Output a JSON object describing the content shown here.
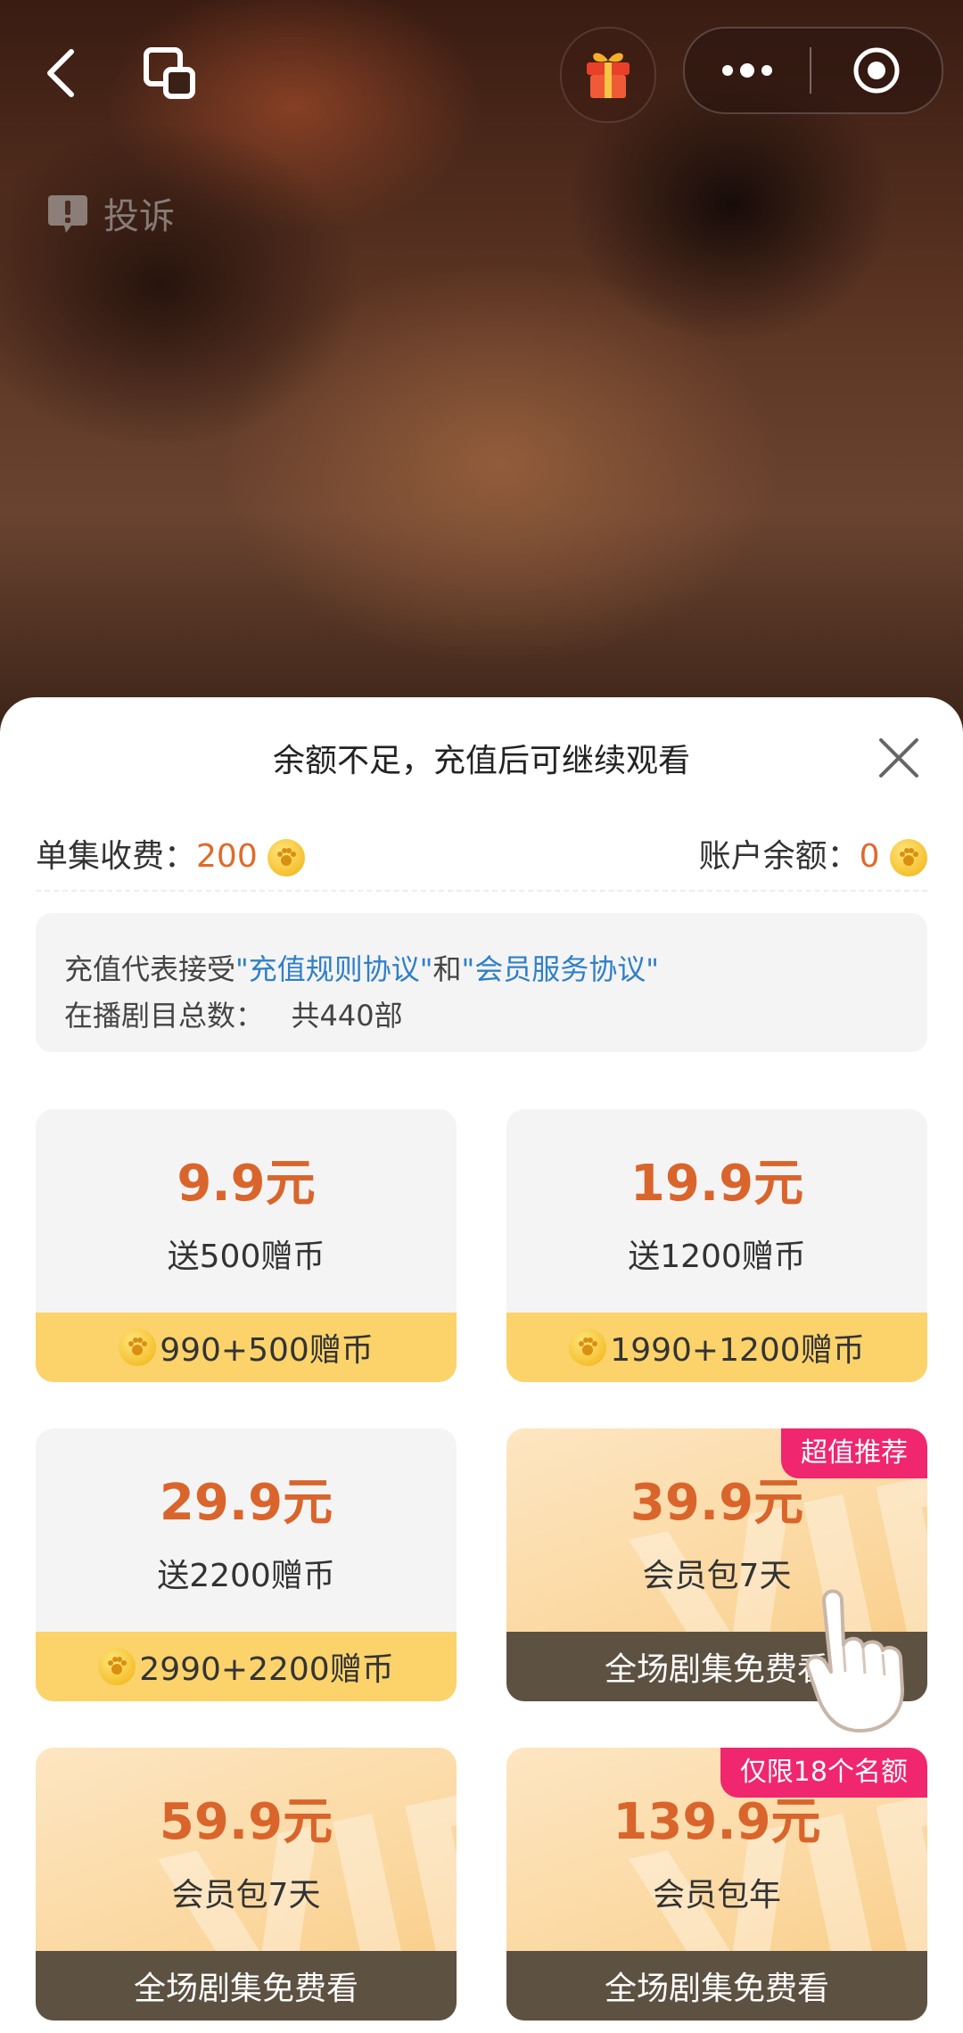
{
  "topbar": {
    "complaint_label": "投诉"
  },
  "sheet": {
    "title": "余额不足，充值后可继续观看",
    "fee_label": "单集收费：",
    "fee_value": "200",
    "balance_label": "账户余额：",
    "balance_value": "0",
    "notice": {
      "prefix": "充值代表接受",
      "link1": "\"充值规则协议\"",
      "middle": "和",
      "link2": "\"会员服务协议\"",
      "line2": "在播剧目总数：   共440部"
    }
  },
  "packages": [
    {
      "price": "9.9元",
      "desc": "送500赠币",
      "foot": "990+500赠币"
    },
    {
      "price": "19.9元",
      "desc": "送1200赠币",
      "foot": "1990+1200赠币"
    },
    {
      "price": "29.9元",
      "desc": "送2200赠币",
      "foot": "2990+2200赠币"
    },
    {
      "price": "39.9元",
      "desc": "会员包7天",
      "foot": "全场剧集免费看",
      "badge": "超值推荐"
    },
    {
      "price": "59.9元",
      "desc": "会员包7天",
      "foot": "全场剧集免费看"
    },
    {
      "price": "139.9元",
      "desc": "会员包年",
      "foot": "全场剧集免费看",
      "badge": "仅限18个名额"
    }
  ],
  "colors": {
    "price": "#d9652c",
    "badge": "#f0266f",
    "coin_footer": "#fbd36a",
    "vip_footer": "#5d5142",
    "link": "#2f7fc9"
  },
  "icons": [
    "back-arrow-icon",
    "copy-window-icon",
    "gift-icon",
    "more-dots-icon",
    "target-icon",
    "alert-icon",
    "close-icon",
    "coin-icon",
    "pointing-hand-icon"
  ]
}
